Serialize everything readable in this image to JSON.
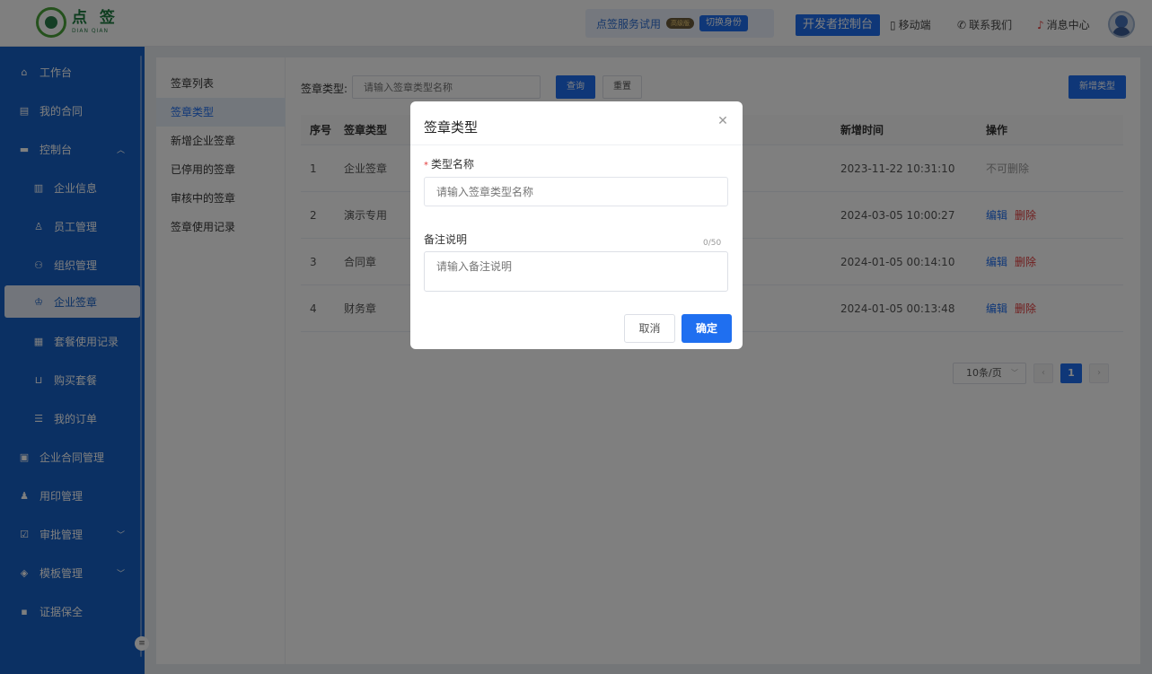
{
  "header": {
    "logo_cn": "点 签",
    "logo_en": "DIAN QIAN",
    "trial_text": "点签服务试用",
    "vip_badge": "高级版",
    "switch_identity": "切换身份",
    "developer_console": "开发者控制台",
    "mobile": "移动端",
    "contact": "联系我们",
    "messages": "消息中心"
  },
  "sidebar": {
    "workbench": "工作台",
    "my_contracts": "我的合同",
    "console": "控制台",
    "company_info": "企业信息",
    "staff": "员工管理",
    "org": "组织管理",
    "seal": "企业签章",
    "package_records": "套餐使用记录",
    "buy_package": "购买套餐",
    "my_orders": "我的订单",
    "contract_mgmt": "企业合同管理",
    "seal_use": "用印管理",
    "approval": "审批管理",
    "template": "模板管理",
    "evidence": "证据保全"
  },
  "subnav": {
    "items": [
      "签章列表",
      "签章类型",
      "新增企业签章",
      "已停用的签章",
      "审核中的签章",
      "签章使用记录"
    ]
  },
  "filter": {
    "label": "签章类型:",
    "placeholder": "请输入签章类型名称",
    "query": "查询",
    "reset": "重置",
    "add": "新增类型"
  },
  "table": {
    "headers": {
      "idx": "序号",
      "type": "签章类型",
      "time": "新增时间",
      "op": "操作"
    },
    "rows": [
      {
        "idx": "1",
        "type": "企业签章",
        "time": "2023-11-22 10:31:10",
        "op_none": "不可删除"
      },
      {
        "idx": "2",
        "type": "演示专用",
        "time": "2024-03-05 10:00:27",
        "edit": "编辑",
        "del": "删除"
      },
      {
        "idx": "3",
        "type": "合同章",
        "time": "2024-01-05 00:14:10",
        "edit": "编辑",
        "del": "删除"
      },
      {
        "idx": "4",
        "type": "财务章",
        "time": "2024-01-05 00:13:48",
        "edit": "编辑",
        "del": "删除"
      }
    ]
  },
  "pagination": {
    "page_size": "10条/页",
    "current": "1"
  },
  "modal": {
    "title": "签章类型",
    "name_label": "类型名称",
    "name_placeholder": "请输入签章类型名称",
    "remark_label": "备注说明",
    "remark_count": "0/50",
    "remark_placeholder": "请输入备注说明",
    "cancel": "取消",
    "confirm": "确定"
  },
  "colors": {
    "primary": "#1f6ff0",
    "sidebar": "#1660c6",
    "danger": "#e23c3c"
  }
}
